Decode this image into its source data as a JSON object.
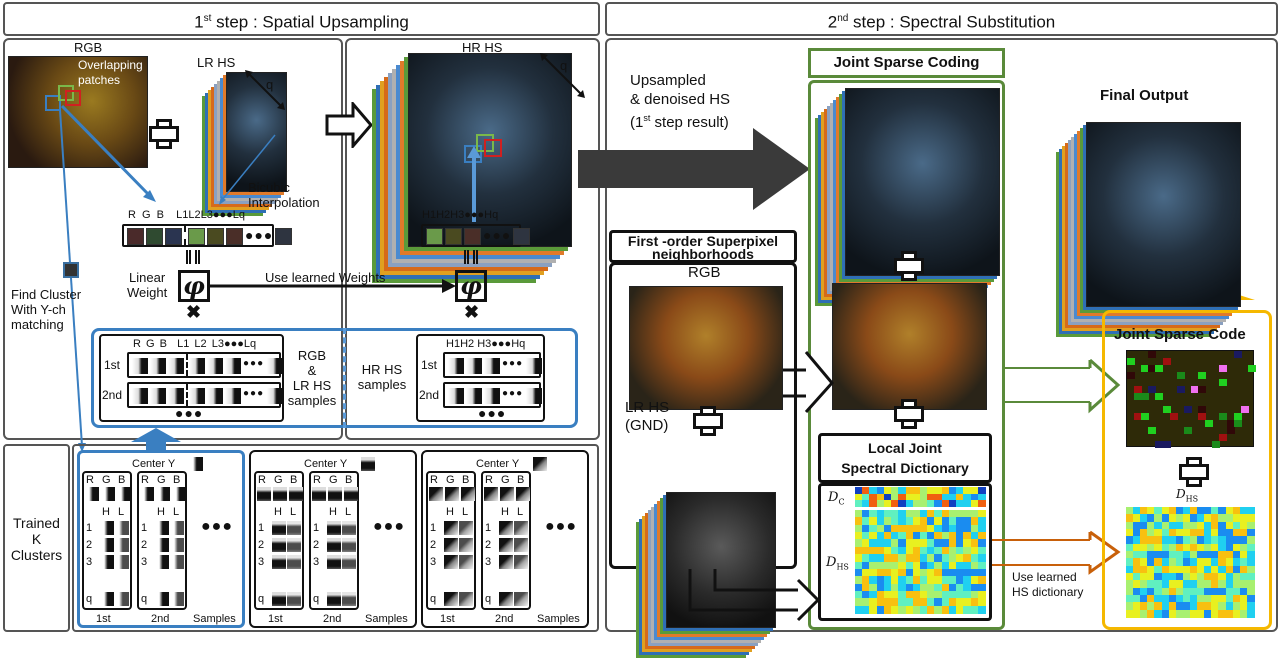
{
  "step1": {
    "title_num": "1",
    "title_sup": "st",
    "title_rest": " step : Spatial Upsampling",
    "rgb_label": "RGB",
    "overlap_label_1": "Overlapping",
    "overlap_label_2": "patches",
    "lrhs_label": "LR HS",
    "hrhs_label": "HR HS",
    "q_label": "q",
    "bicubic_1": "Bicubic",
    "bicubic_2": "Interpolation",
    "rgb_channels": [
      "R",
      "G",
      "B"
    ],
    "lr_channels": [
      "L1",
      "L2",
      "L3",
      "●●●",
      "Lq"
    ],
    "hr_channels": [
      "H1",
      "H2",
      "H3",
      "●●●",
      "Hq"
    ],
    "linear_weight_1": "Linear",
    "linear_weight_2": "Weight",
    "phi": "φ",
    "use_learned_weights": "Use learned  Weights",
    "find_cluster_1": "Find Cluster",
    "find_cluster_2": "With Y-ch",
    "find_cluster_3": "matching",
    "row_1st": "1st",
    "row_2nd": "2nd",
    "ellipsis": "●●●",
    "rgb_lr_samples": [
      "RGB",
      "&",
      "LR HS",
      "samples"
    ],
    "hr_samples": [
      "HR HS",
      "samples"
    ],
    "patch_colors_rgb": [
      "#4a2a2a",
      "#2f4a30",
      "#2a3450"
    ],
    "patch_colors_lr": [
      "#6a9a4a",
      "#4a4a20",
      "#4a2e28",
      "#2e3440"
    ],
    "patch_colors_hr": [
      "#6a9a4a",
      "#4a4a20",
      "#4a2e28",
      "#2e3440"
    ]
  },
  "clusters": {
    "label": [
      "Trained",
      "K",
      "Clusters"
    ],
    "center_y": "Center Y",
    "channels": [
      "R",
      "G",
      "B"
    ],
    "hl": [
      "H",
      "L"
    ],
    "rows": [
      "1",
      "2",
      "3",
      "q"
    ],
    "sample_labels": [
      "1st",
      "2nd"
    ],
    "samples_label": "Samples",
    "ellipsis": "●●●",
    "active_color": "#3a7fc1"
  },
  "step2": {
    "title_num": "2",
    "title_sup": "nd",
    "title_rest": " step : Spectral Substitution",
    "upsampled": [
      "Upsampled",
      "& denoised HS"
    ],
    "result_1": "(1",
    "result_sup": "st",
    "result_2": "  step result)",
    "joint_sparse_coding": "Joint Sparse Coding",
    "superpixel_1": "First -order Superpixel",
    "superpixel_2": "neighborhoods",
    "rgb_label": "RGB",
    "lrhs_gnd_1": "LR HS",
    "lrhs_gnd_2": "(GND)",
    "dict_1": "Local Joint",
    "dict_2": "Spectral Dictionary",
    "dc_label": "D",
    "dc_sub": "C",
    "dhs_label": "D",
    "dhs_sub": "HS",
    "use_dict_1": "Use learned",
    "use_dict_2": "HS dictionary",
    "final_output": "Final Output",
    "joint_sparse_code": "Joint Sparse Code",
    "green": "#5a8a3a",
    "orange": "#c8600a",
    "yellow": "#f5b800",
    "dark_arrow": "#3a3a3a"
  },
  "stack_colors": [
    "#5a9a3a",
    "#2f6fb5",
    "#e0a020",
    "#d66a1a",
    "#8aa0c0",
    "#b0b0b0",
    "#4a8ad0",
    "#e07a2a"
  ],
  "jet_palette": [
    "#1040c0",
    "#1a8cf0",
    "#20d0f0",
    "#60f0c0",
    "#a8f070",
    "#e8f020",
    "#f8c010",
    "#f06010"
  ]
}
